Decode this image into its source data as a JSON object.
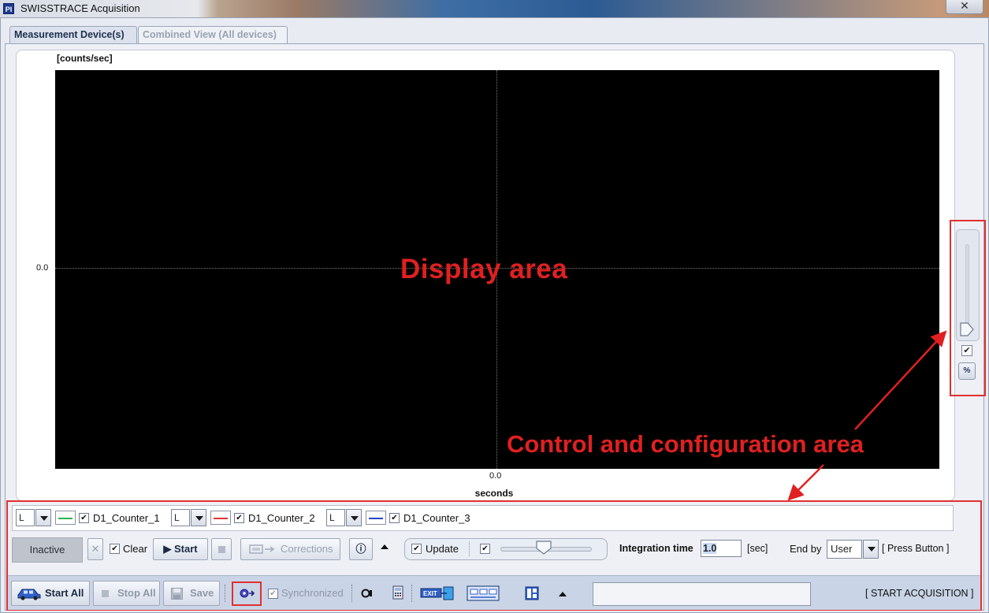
{
  "window": {
    "title": "SWISSTRACE Acquisition",
    "icon_text": "PI",
    "close_glyph": "✕"
  },
  "tabs": [
    {
      "label": "Measurement Device(s)",
      "active": true
    },
    {
      "label": "Combined View (All devices)",
      "active": false
    }
  ],
  "plot": {
    "y_axis_label": "[counts/sec]",
    "y_tick": "0.0",
    "x_tick": "0.0",
    "x_axis_label": "seconds",
    "background": "#000000"
  },
  "annotations": {
    "display_area": "Display area",
    "control_area": "Control and configuration area",
    "color": "#e02020"
  },
  "right_panel": {
    "checkbox": "✔",
    "percent_label": "%"
  },
  "series": [
    {
      "axis": "L",
      "name": "D1_Counter_1",
      "color": "#2db34a",
      "checked": "✔"
    },
    {
      "axis": "L",
      "name": "D1_Counter_2",
      "color": "#e03535",
      "checked": "✔"
    },
    {
      "axis": "L",
      "name": "D1_Counter_3",
      "color": "#2a44c9",
      "checked": "✔"
    }
  ],
  "controls": {
    "inactive_label": "Inactive",
    "x_glyph": "✕",
    "clear_label": "Clear",
    "clear_checked": "✔",
    "start_label": "▶ Start",
    "corrections_label": "Corrections",
    "info_glyph": "ⓘ",
    "update_label": "Update",
    "update_checked": "✔",
    "update_second_checked": "✔",
    "update_level": 0.5,
    "integration_label": "Integration time",
    "integration_value": "1.0",
    "integration_unit": "[sec]",
    "end_by_label": "End by",
    "end_by_value": "User",
    "press_button_label": "[ Press Button ]"
  },
  "bottom": {
    "start_all_label": "Start All",
    "stop_all_label": "Stop All",
    "save_label": "Save",
    "synchronized_label": "Synchronized",
    "synchronized_checked": "✔",
    "status_text": "",
    "start_acquisition_label": "[ START ACQUISITION ]"
  }
}
